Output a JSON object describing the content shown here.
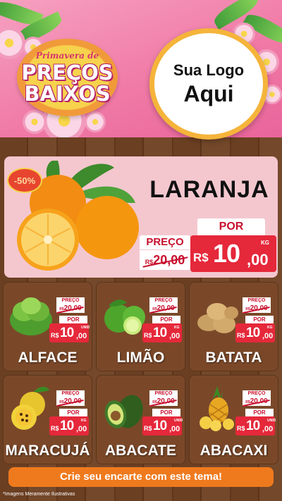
{
  "header": {
    "badge_top": "Primavera de",
    "badge_line1": "PREÇOS",
    "badge_line2": "BAIXOS",
    "logo_line1": "Sua Logo",
    "logo_line2": "Aqui"
  },
  "featured": {
    "discount": "-50%",
    "name": "LARANJA",
    "price_label": "PREÇO",
    "old_currency": "R$",
    "old_price": "20,00",
    "por_label": "POR",
    "currency": "R$",
    "price_int": "10",
    "price_dec": ",00",
    "unit": "KG"
  },
  "products": [
    {
      "name": "ALFACE",
      "price_label": "PREÇO",
      "old_currency": "R$",
      "old_price": "20,00",
      "por_label": "POR",
      "currency": "R$",
      "price_int": "10",
      "price_dec": ",00",
      "unit": "UNID"
    },
    {
      "name": "LIMÃO",
      "price_label": "PREÇO",
      "old_currency": "R$",
      "old_price": "20,00",
      "por_label": "POR",
      "currency": "R$",
      "price_int": "10",
      "price_dec": ",00",
      "unit": "KG"
    },
    {
      "name": "BATATA",
      "price_label": "PREÇO",
      "old_currency": "R$",
      "old_price": "20,00",
      "por_label": "POR",
      "currency": "R$",
      "price_int": "10",
      "price_dec": ",00",
      "unit": "KG"
    },
    {
      "name": "MARACUJÁ",
      "price_label": "PREÇO",
      "old_currency": "R$",
      "old_price": "20,00",
      "por_label": "POR",
      "currency": "R$",
      "price_int": "10",
      "price_dec": ",00",
      "unit": "KG"
    },
    {
      "name": "ABACATE",
      "price_label": "PREÇO",
      "old_currency": "R$",
      "old_price": "20,00",
      "por_label": "POR",
      "currency": "R$",
      "price_int": "10",
      "price_dec": ",00",
      "unit": "UNID"
    },
    {
      "name": "ABACAXI",
      "price_label": "PREÇO",
      "old_currency": "R$",
      "old_price": "20,00",
      "por_label": "POR",
      "currency": "R$",
      "price_int": "10",
      "price_dec": ",00",
      "unit": "UNID"
    }
  ],
  "footer": {
    "cta": "Crie seu encarte com este tema!",
    "disclaimer": "*Imagens Meramente Ilustrativas"
  },
  "colors": {
    "header_pink": "#f07aa6",
    "price_red": "#e5283a",
    "badge_yellow": "#f7d24c",
    "cta_orange": "#ef7a1e",
    "wood": "#6b3f22"
  }
}
